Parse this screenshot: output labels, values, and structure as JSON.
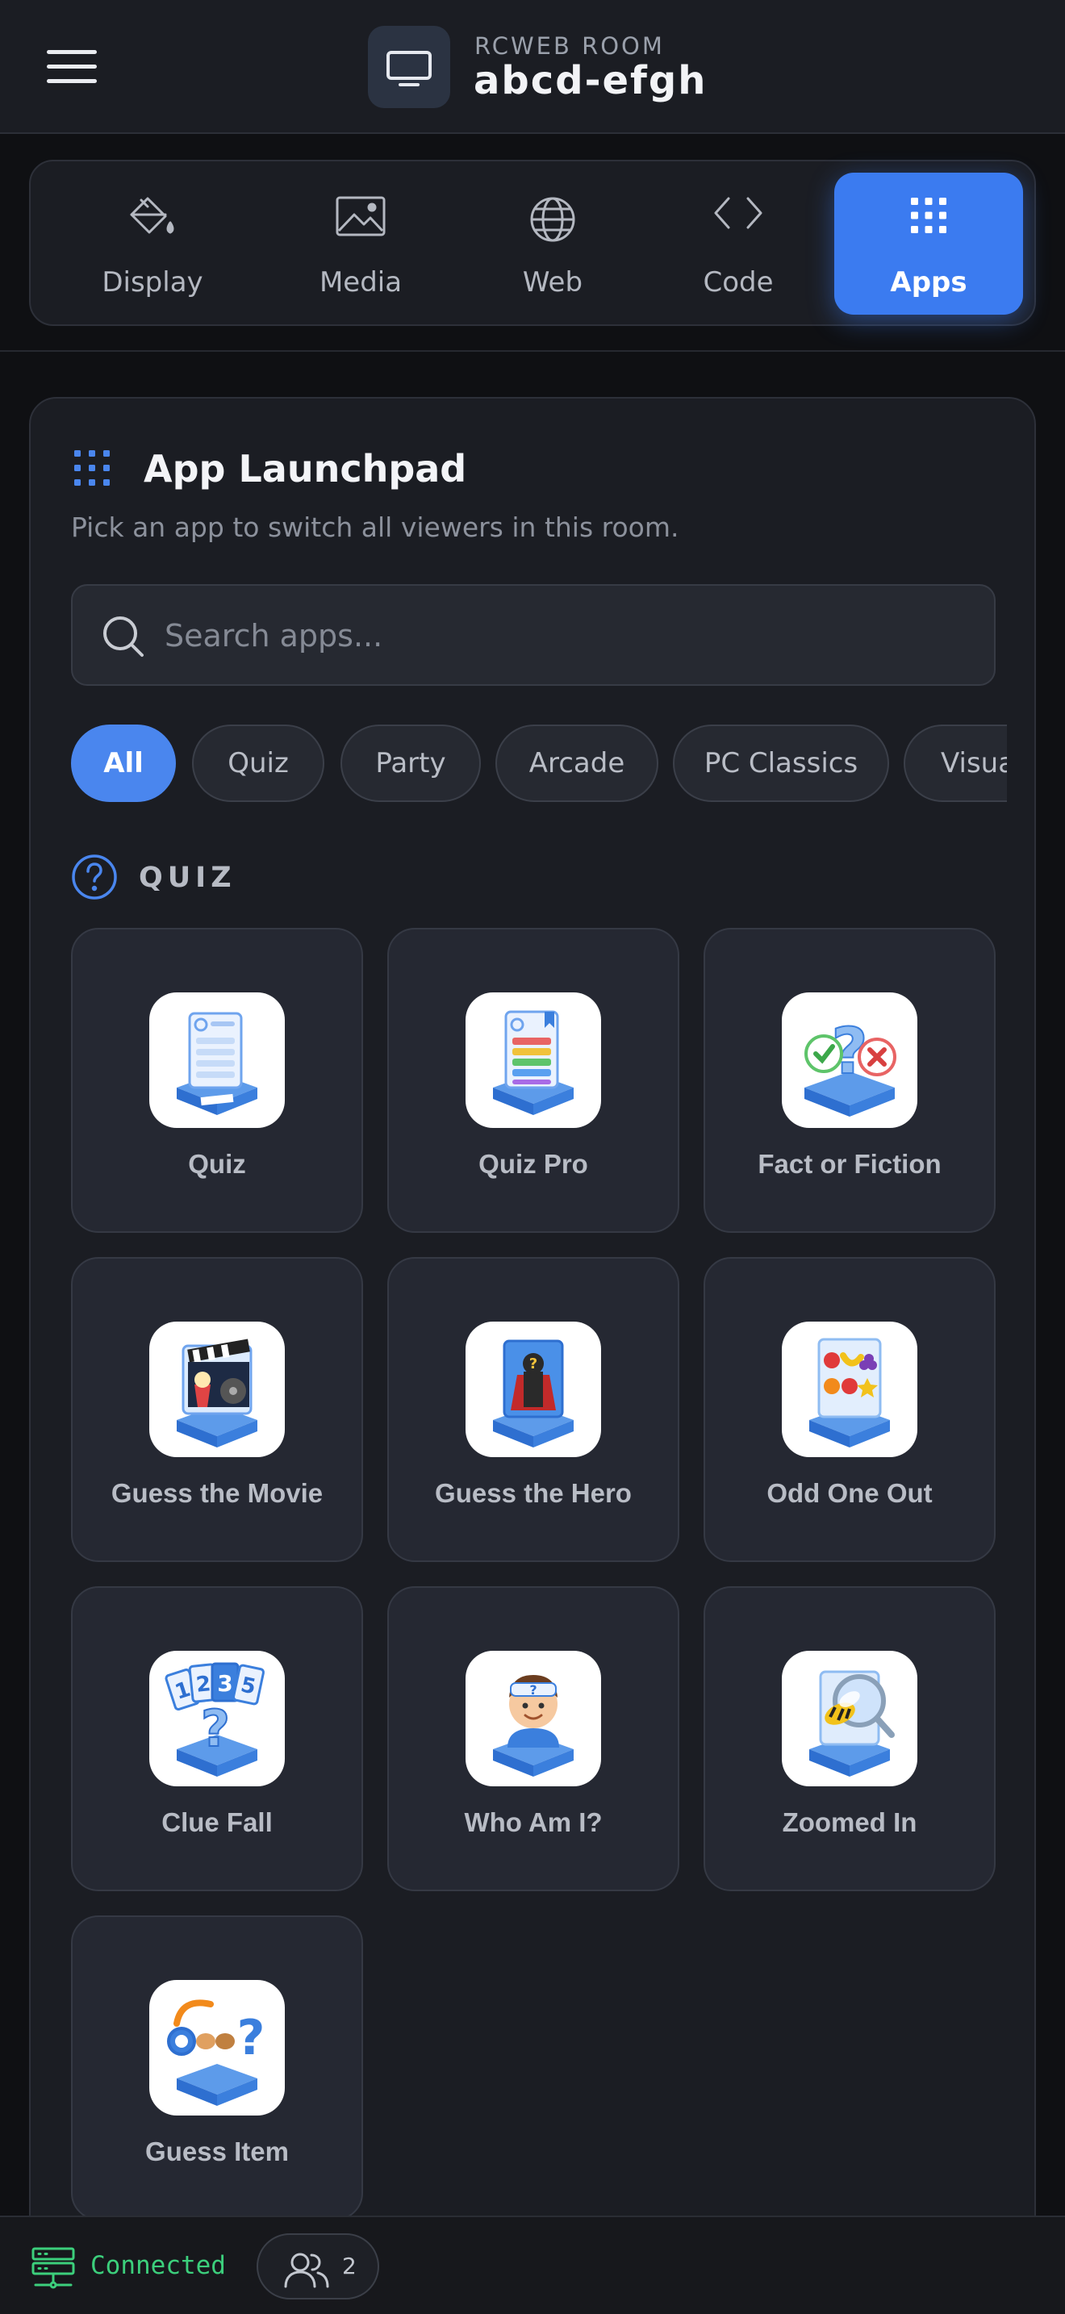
{
  "header": {
    "menu_icon": "hamburger-menu-icon",
    "room_icon": "monitor-icon",
    "room_label": "RCWEB ROOM",
    "room_name": "abcd-efgh"
  },
  "tabs": [
    {
      "label": "Display",
      "icon": "paint-bucket-icon",
      "active": false
    },
    {
      "label": "Media",
      "icon": "image-icon",
      "active": false
    },
    {
      "label": "Web",
      "icon": "globe-icon",
      "active": false
    },
    {
      "label": "Code",
      "icon": "code-icon",
      "active": false
    },
    {
      "label": "Apps",
      "icon": "grid-icon",
      "active": true
    }
  ],
  "launchpad": {
    "title": "App Launchpad",
    "subtitle": "Pick an app to switch all viewers in this room.",
    "search_placeholder": "Search apps...",
    "filters": [
      "All",
      "Quiz",
      "Party",
      "Arcade",
      "PC Classics",
      "Visua"
    ],
    "active_filter": "All",
    "section": {
      "icon": "question-circle-icon",
      "title": "QUIZ",
      "apps": [
        {
          "name": "Quiz",
          "icon": "quiz-icon"
        },
        {
          "name": "Quiz Pro",
          "icon": "quiz-pro-icon"
        },
        {
          "name": "Fact or Fiction",
          "icon": "fact-or-fiction-icon"
        },
        {
          "name": "Guess the Movie",
          "icon": "guess-the-movie-icon"
        },
        {
          "name": "Guess the Hero",
          "icon": "guess-the-hero-icon"
        },
        {
          "name": "Odd One Out",
          "icon": "odd-one-out-icon"
        },
        {
          "name": "Clue Fall",
          "icon": "clue-fall-icon"
        },
        {
          "name": "Who Am I?",
          "icon": "who-am-i-icon"
        },
        {
          "name": "Zoomed In",
          "icon": "zoomed-in-icon"
        },
        {
          "name": "Guess Item",
          "icon": "guess-item-icon"
        }
      ]
    }
  },
  "status": {
    "connection_icon": "server-icon",
    "connection_text": "Connected",
    "connection_color": "#3ccf7c",
    "users_icon": "users-icon",
    "users_count": "2"
  },
  "colors": {
    "accent": "#3b7bf0",
    "background": "#0f1013",
    "panel": "#1b1d23",
    "card": "#252832"
  }
}
